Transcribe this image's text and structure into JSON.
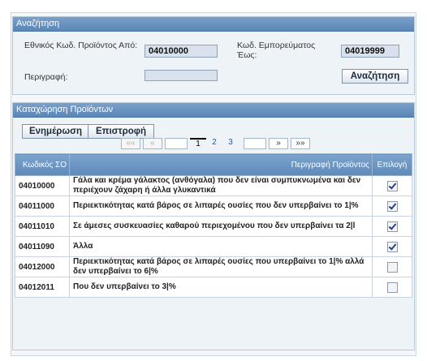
{
  "search": {
    "title": "Αναζήτηση",
    "code_from_label": "Εθνικός Κωδ. Προϊόντος Από:",
    "code_from_value": "04010000",
    "code_to_label": "Κωδ. Εμπορεύματος Έως:",
    "code_to_value": "04019999",
    "description_label": "Περιγραφή:",
    "description_value": "",
    "search_button": "Αναζήτηση"
  },
  "list": {
    "title": "Καταχώρηση Προϊόντων",
    "update_button": "Ενημέρωση",
    "back_button": "Επιστροφή",
    "pager": {
      "first": "««",
      "prev": "«",
      "pages": [
        "1",
        "2",
        "3"
      ],
      "current": "1",
      "next": "»",
      "last": "»»"
    },
    "columns": [
      "Κωδικός ΣΟ",
      "Περιγραφή Προϊόντος",
      "Επιλογή"
    ],
    "rows": [
      {
        "code": "04010000",
        "description": "Γάλα και κρέμα γάλακτος (ανθόγαλα) που δεν είναι συμπυκνωμένα και δεν περιέχουν ζάχαρη ή άλλα γλυκαντικά",
        "selected": true
      },
      {
        "code": "04011000",
        "description": "Περιεκτικότητας κατά βάρος σε λιπαρές ουσίες που δεν υπερβαίνει το 1|%",
        "selected": true
      },
      {
        "code": "04011010",
        "description": "Σε άμεσες συσκευασίες καθαρού περιεχομένου που δεν υπερβαίνει τα 2|l",
        "selected": true
      },
      {
        "code": "04011090",
        "description": "Άλλα",
        "selected": true
      },
      {
        "code": "04012000",
        "description": "Περιεκτικότητας κατά βάρος σε λιπαρές ουσίες που υπερβαίνει το 1|% αλλά δεν υπερβαίνει το 6|%",
        "selected": false
      },
      {
        "code": "04012011",
        "description": "Που δεν υπερβαίνει το 3|%",
        "selected": false
      }
    ]
  }
}
